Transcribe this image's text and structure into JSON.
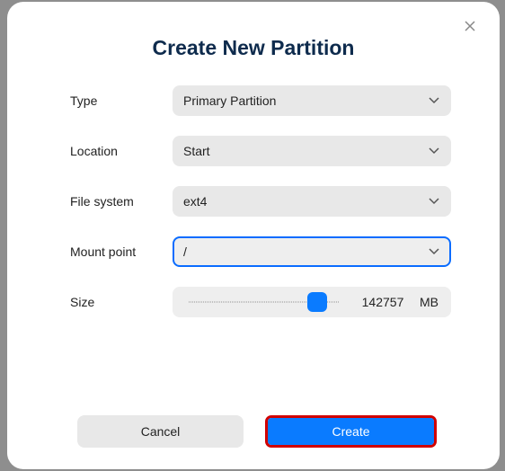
{
  "dialog": {
    "title": "Create New Partition",
    "fields": {
      "type": {
        "label": "Type",
        "value": "Primary Partition"
      },
      "location": {
        "label": "Location",
        "value": "Start"
      },
      "filesystem": {
        "label": "File system",
        "value": "ext4"
      },
      "mountpoint": {
        "label": "Mount point",
        "value": "/"
      },
      "size": {
        "label": "Size",
        "value": "142757",
        "unit": "MB"
      }
    },
    "buttons": {
      "cancel": "Cancel",
      "create": "Create"
    }
  }
}
